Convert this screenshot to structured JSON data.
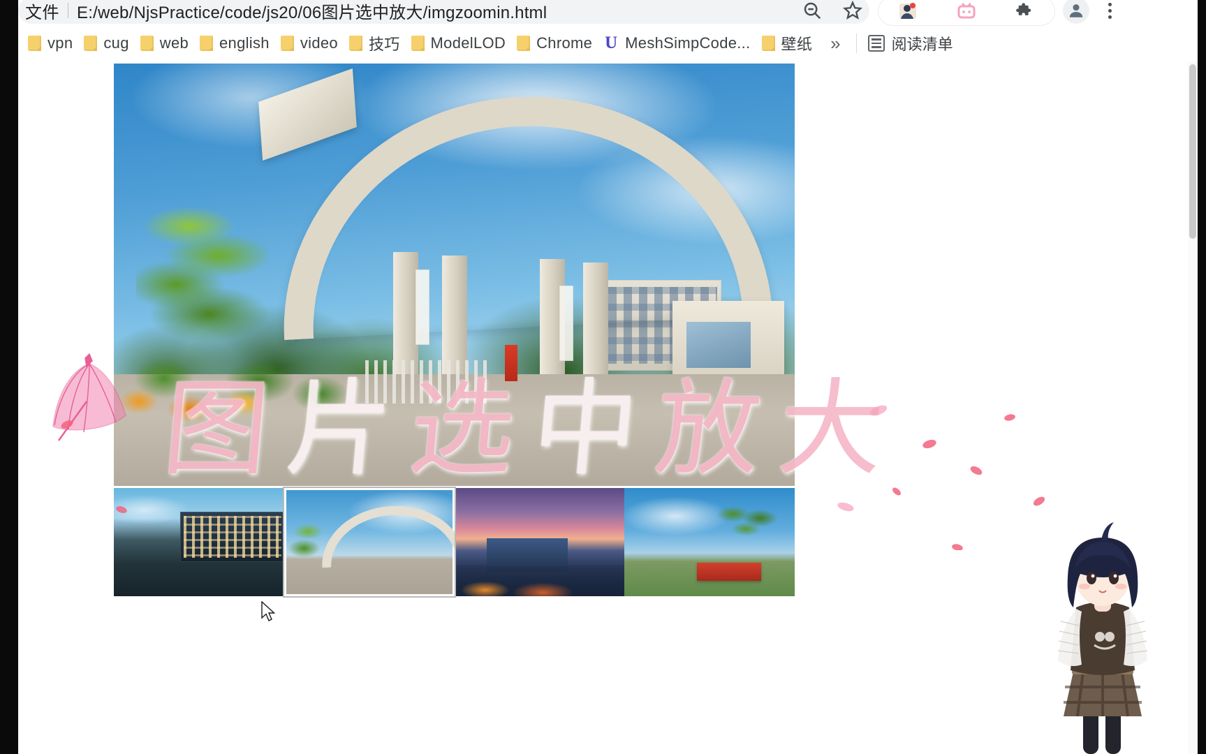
{
  "browser": {
    "omnibox": {
      "scheme_label": "文件",
      "url": "E:/web/NjsPractice/code/js20/06图片选中放大/imgzoomin.html",
      "zoom_out_icon": "zoom-out-magnifier-icon",
      "bookmark_star_icon": "bookmark-star-icon"
    },
    "extensions": [
      {
        "name": "avatar-extension-icon",
        "color": "#c8a07a"
      },
      {
        "name": "pink-tv-extension-icon",
        "color": "#f6a3bd"
      },
      {
        "name": "puzzle-extensions-icon",
        "color": "#5f6368"
      }
    ],
    "profile_icon": "profile-avatar-icon",
    "menu_icon": "three-dot-menu-icon",
    "bookmarks": [
      {
        "label": "vpn",
        "icon": "folder-icon"
      },
      {
        "label": "cug",
        "icon": "folder-icon"
      },
      {
        "label": "web",
        "icon": "folder-icon"
      },
      {
        "label": "english",
        "icon": "folder-icon"
      },
      {
        "label": "video",
        "icon": "folder-icon"
      },
      {
        "label": "技巧",
        "icon": "folder-icon"
      },
      {
        "label": "ModelLOD",
        "icon": "folder-icon"
      },
      {
        "label": "Chrome",
        "icon": "folder-icon"
      },
      {
        "label": "MeshSimpCode...",
        "icon": "u-letter-icon"
      },
      {
        "label": "壁纸",
        "icon": "folder-icon"
      }
    ],
    "bookmarks_overflow_label": "»",
    "reading_list": {
      "label": "阅读清单",
      "icon": "reading-list-icon"
    }
  },
  "page": {
    "main_image": {
      "name": "university-gate-main-photo",
      "alt": "中国地质大学校门 主图",
      "selected_index": 1
    },
    "thumbnails": [
      {
        "alt": "校园湖景与教学楼",
        "selected": false
      },
      {
        "alt": "学校大门",
        "selected": true
      },
      {
        "alt": "黄昏校园俯瞰",
        "selected": false
      },
      {
        "alt": "棕榈树与校名石碑",
        "selected": false
      }
    ]
  },
  "overlay": {
    "title_chars": [
      "图",
      "片",
      "选",
      "中",
      "放",
      "大"
    ],
    "title_text": "图片选中放大",
    "decorations": {
      "parasol": "pink-parasol-decoration",
      "petals": "falling-petals-decoration",
      "character": "anime-girl-character-overlay"
    },
    "colors": {
      "pink": "#f6b8c8",
      "white": "#fdf3f5",
      "parasol": "#e8568f",
      "petal": "#f2637e"
    }
  }
}
